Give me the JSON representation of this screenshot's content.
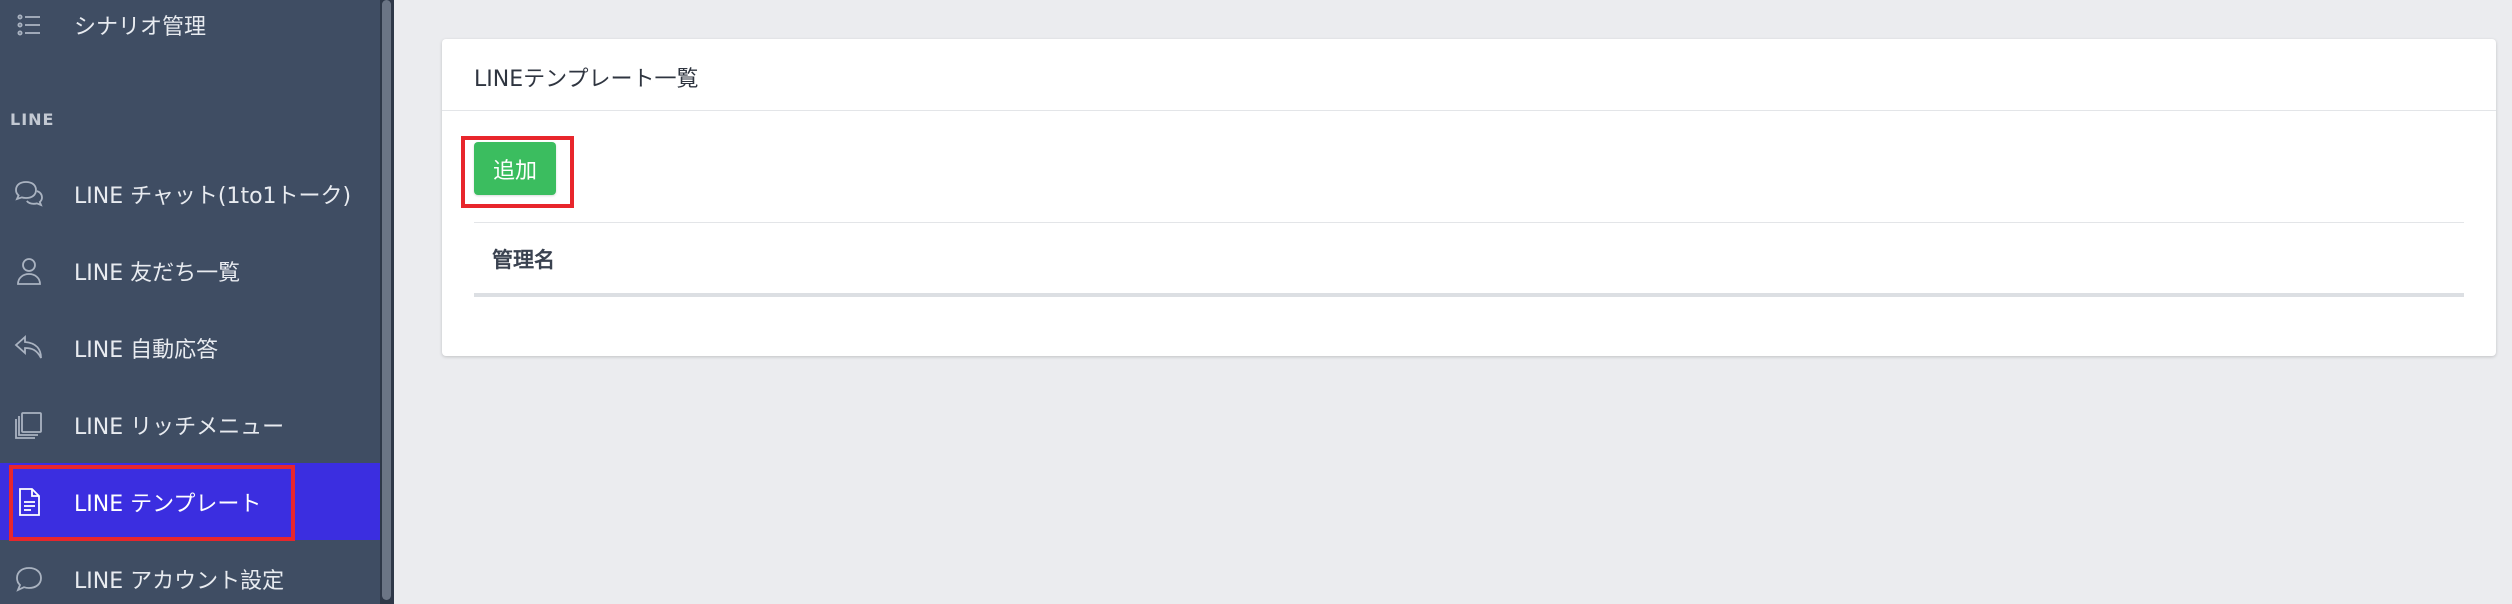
{
  "sidebar": {
    "top_item": {
      "label": "シナリオ管理",
      "icon": "list-icon"
    },
    "section_label": "LINE",
    "items": [
      {
        "label": "LINE チャット(1to1トーク)",
        "icon": "chat-bubbles-icon"
      },
      {
        "label": "LINE 友だち一覧",
        "icon": "user-icon"
      },
      {
        "label": "LINE 自動応答",
        "icon": "reply-icon"
      },
      {
        "label": "LINE リッチメニュー",
        "icon": "layers-icon"
      },
      {
        "label": "LINE テンプレート",
        "icon": "document-icon",
        "active": true
      },
      {
        "label": "LINE アカウント設定",
        "icon": "speech-bubble-icon"
      }
    ],
    "active_color": "#3b2ee0",
    "background_color": "#3f4d63"
  },
  "main": {
    "card_title": "LINEテンプレート一覧",
    "add_button_label": "追加",
    "add_button_color": "#3bbd5f",
    "table": {
      "columns": [
        "管理名"
      ],
      "rows": []
    }
  },
  "annotations": {
    "highlight_color": "#e8262c"
  }
}
